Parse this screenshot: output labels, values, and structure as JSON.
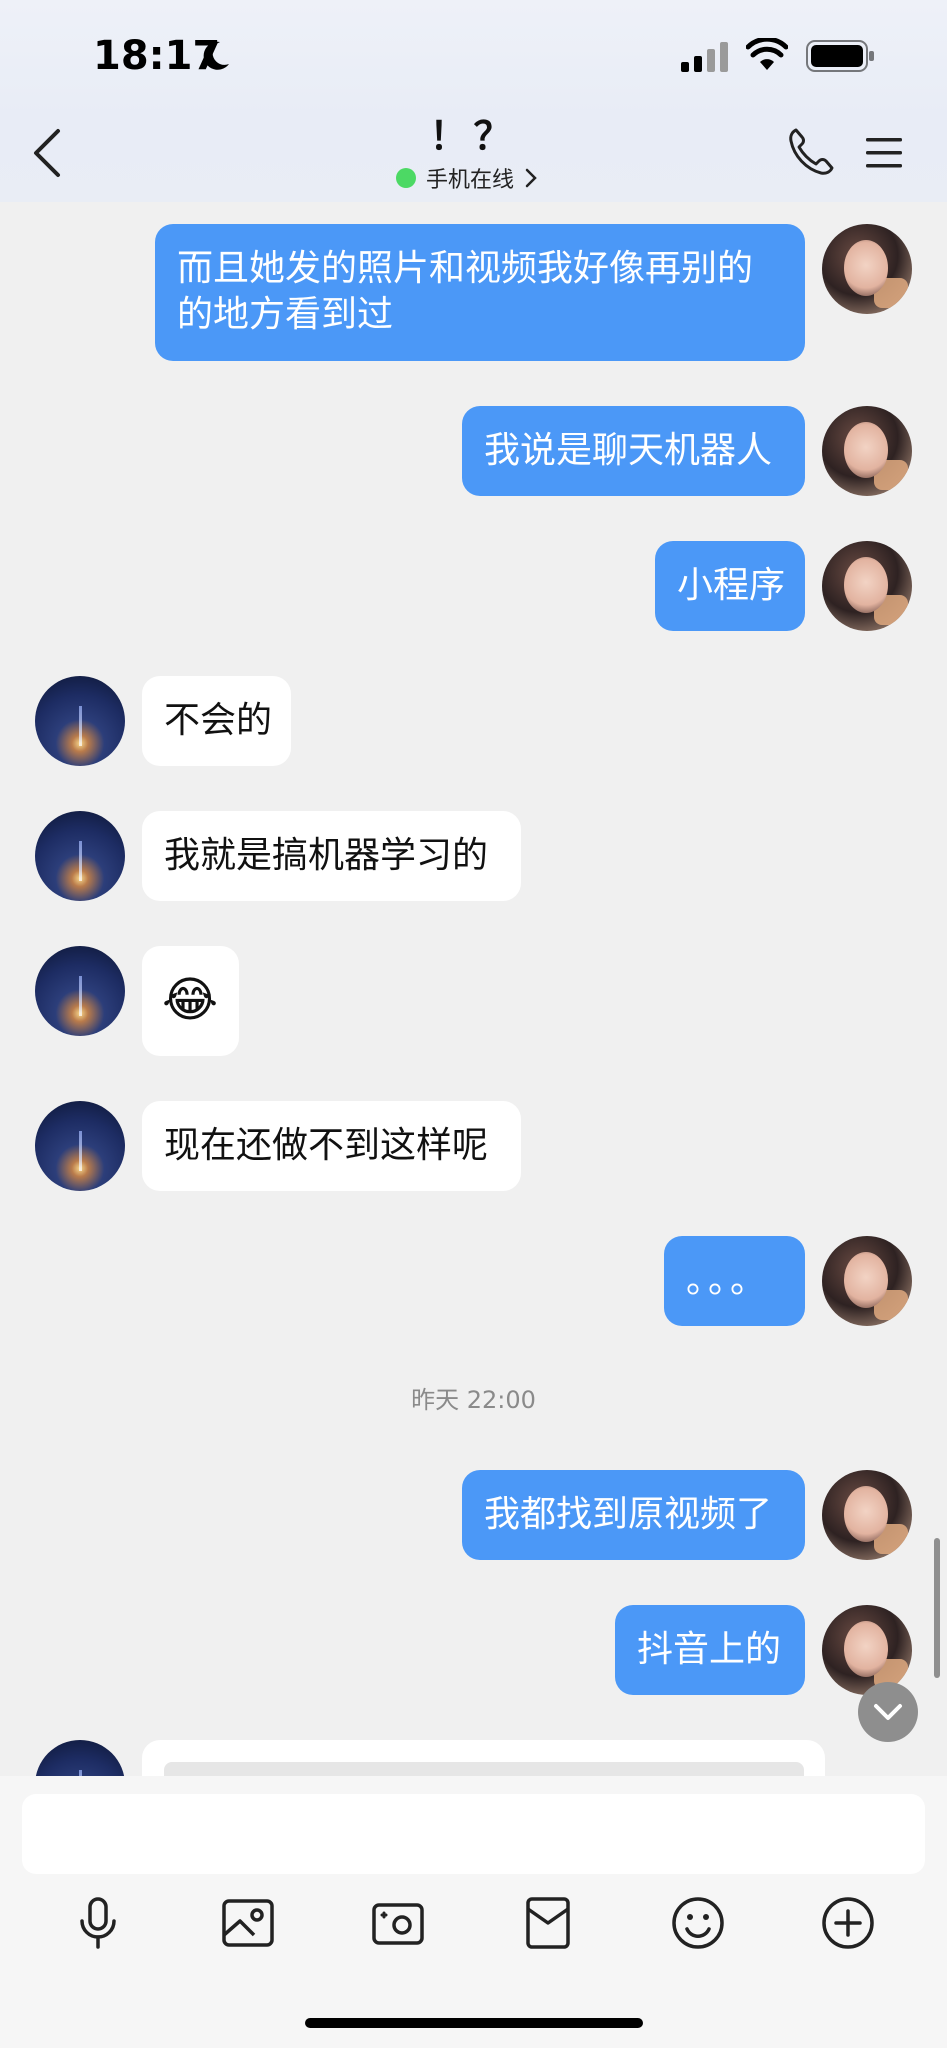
{
  "status_bar": {
    "time": "18:17",
    "icons": [
      "moon-icon",
      "signal-icon",
      "wifi-icon",
      "battery-icon"
    ]
  },
  "header": {
    "title": "！？",
    "presence": "手机在线",
    "icons": [
      "back-chevron-icon",
      "phone-icon",
      "menu-icon"
    ]
  },
  "messages": [
    {
      "from": "me",
      "text": "而且她发的照片和视频我好像再别的的地方看到过"
    },
    {
      "from": "me",
      "text": "我说是聊天机器人"
    },
    {
      "from": "me",
      "text": "小程序"
    },
    {
      "from": "peer",
      "text": "不会的"
    },
    {
      "from": "peer",
      "text": "我就是搞机器学习的"
    },
    {
      "from": "peer",
      "text": "😂"
    },
    {
      "from": "peer",
      "text": "现在还做不到这样呢"
    },
    {
      "from": "me",
      "text": "。。。"
    },
    {
      "from": "me",
      "text": "我都找到原视频了"
    },
    {
      "from": "me",
      "text": "抖音上的"
    }
  ],
  "timestamp": "昨天 22:00",
  "composer": {
    "input_value": "",
    "tools": [
      "mic-icon",
      "image-icon",
      "camera-icon",
      "red-packet-icon",
      "emoji-icon",
      "plus-icon"
    ]
  },
  "colors": {
    "outgoing": "#4b98f7",
    "incoming": "#ffffff",
    "background": "#f0f0f0",
    "online": "#4cd964"
  }
}
